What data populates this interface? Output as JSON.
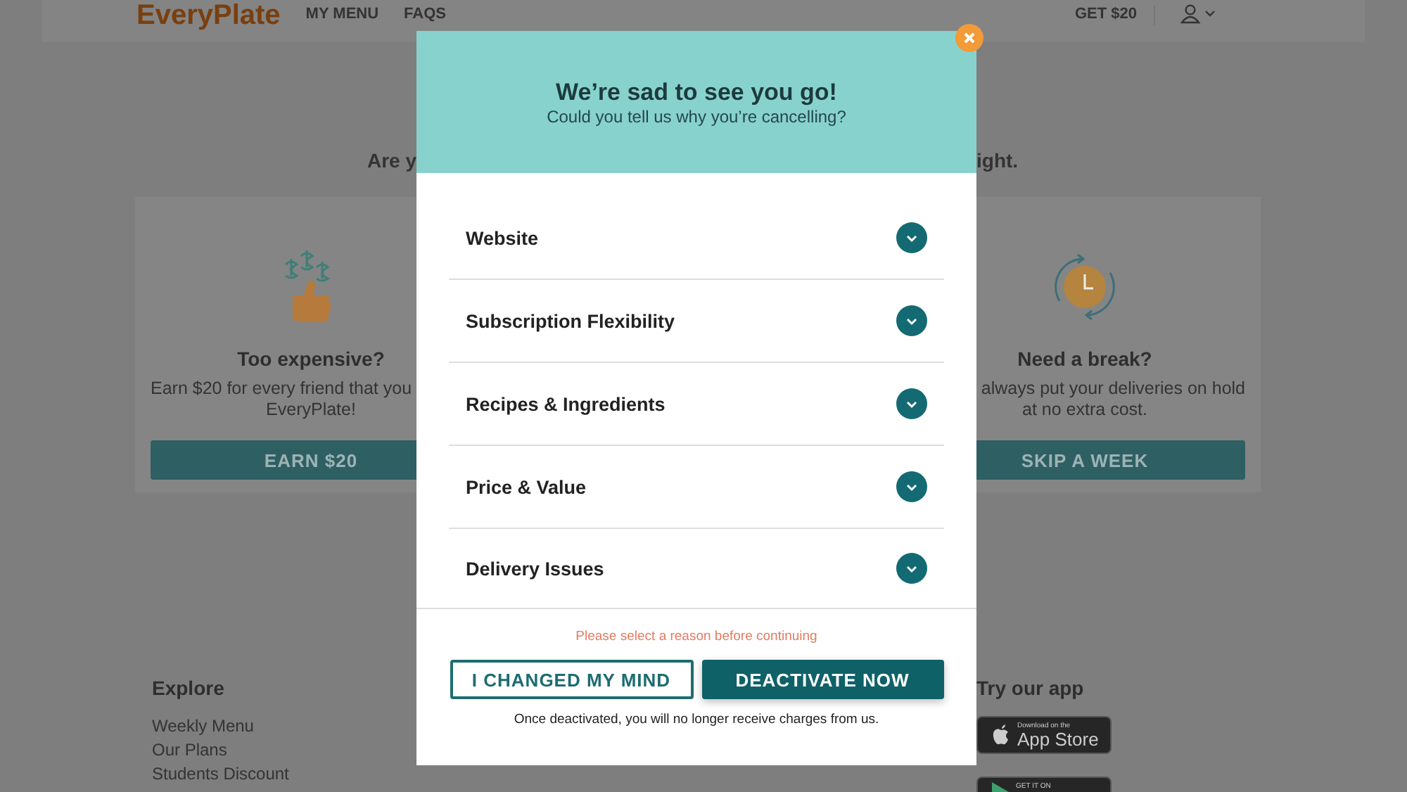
{
  "header": {
    "logo": "EveryPlate",
    "nav": [
      "MY MENU",
      "FAQS"
    ],
    "referral": "GET $20"
  },
  "intro": {
    "left_part": "Are y",
    "right_part": "ight."
  },
  "offers": [
    {
      "kind": "refer",
      "title": "Too expensive?",
      "lines": [
        "Earn $20 for every friend that you",
        "EveryPlate!"
      ],
      "button": "EARN $20"
    },
    {
      "kind": "pause",
      "title": "Need a break?",
      "lines": [
        "always put your deliveries on hold",
        "at no extra cost."
      ],
      "button": "SKIP A WEEK"
    }
  ],
  "footer": {
    "explore": {
      "heading": "Explore",
      "links": [
        "Weekly Menu",
        "Our Plans",
        "Students Discount"
      ]
    },
    "app": {
      "heading": "Try our app",
      "badges": [
        {
          "kind": "apple",
          "small": "Download on the",
          "large": "App Store"
        },
        {
          "kind": "google",
          "small": "GET IT ON"
        }
      ]
    }
  },
  "modal": {
    "title": "We’re sad to see you go!",
    "subtitle": "Could you tell us why you’re cancelling?",
    "reasons": [
      {
        "label": "Website",
        "expanded": false
      },
      {
        "label": "Subscription Flexibility",
        "expanded": false
      },
      {
        "label": "Recipes & Ingredients",
        "expanded": false
      },
      {
        "label": "Price & Value",
        "expanded": false
      },
      {
        "label": "Delivery Issues",
        "expanded": false
      }
    ],
    "error": "Please select a reason before continuing",
    "buttons": [
      {
        "kind": "secondary",
        "label": "I CHANGED MY MIND"
      },
      {
        "kind": "primary",
        "label": "DEACTIVATE NOW"
      }
    ],
    "note": "Once deactivated, you will no longer receive charges from us."
  }
}
